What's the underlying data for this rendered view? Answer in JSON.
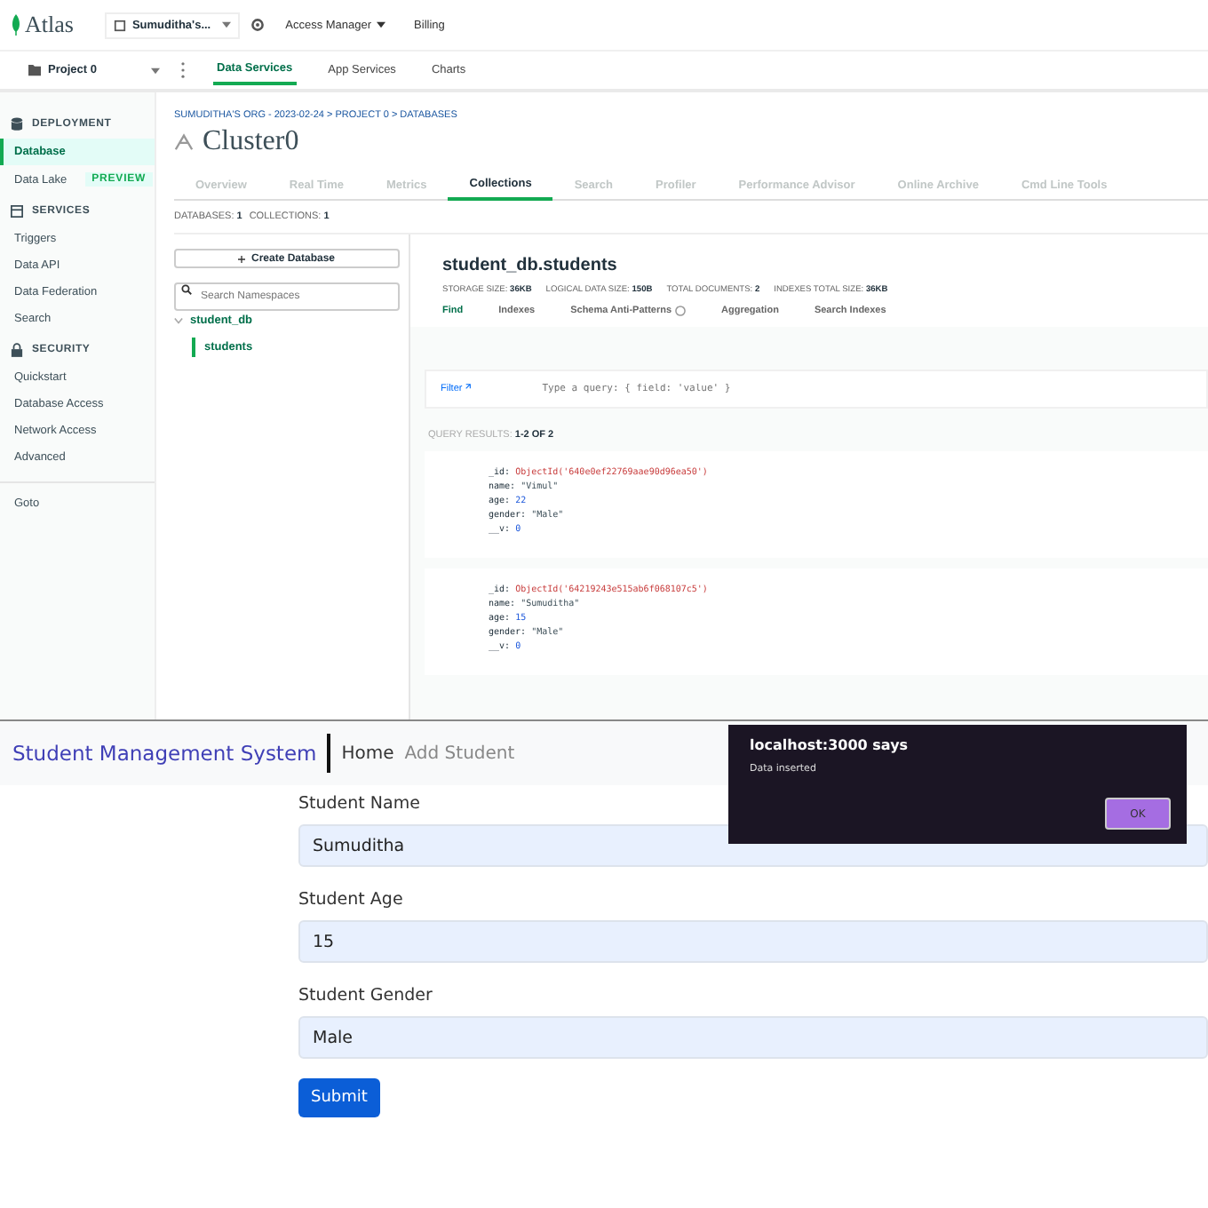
{
  "atlas": {
    "topbar": {
      "logo": "Atlas",
      "org": "Sumuditha's...",
      "nav": [
        {
          "label": "Access Manager",
          "kind": "dropdown"
        },
        {
          "label": "Billing",
          "kind": "link"
        }
      ]
    },
    "projectbar": {
      "project": "Project 0",
      "tabs": [
        {
          "label": "Data Services",
          "selected": true
        },
        {
          "label": "App Services",
          "selected": false
        },
        {
          "label": "Charts",
          "selected": false
        }
      ]
    },
    "sidebar": {
      "sections": [
        {
          "title": "DEPLOYMENT",
          "items": [
            {
              "label": "Database",
              "selected": true
            },
            {
              "label": "Data Lake",
              "selected": false,
              "badge": "PREVIEW"
            }
          ]
        },
        {
          "title": "SERVICES",
          "items": [
            {
              "label": "Triggers",
              "selected": false
            },
            {
              "label": "Data API",
              "selected": false
            },
            {
              "label": "Data Federation",
              "selected": false
            },
            {
              "label": "Search",
              "selected": false
            }
          ]
        },
        {
          "title": "SECURITY",
          "items": [
            {
              "label": "Quickstart",
              "selected": false
            },
            {
              "label": "Database Access",
              "selected": false
            },
            {
              "label": "Network Access",
              "selected": false
            },
            {
              "label": "Advanced",
              "selected": false
            }
          ]
        }
      ],
      "footer": "Goto"
    },
    "breadcrumb": "SUMUDITHA'S ORG - 2023-02-24 > PROJECT 0 > DATABASES",
    "cluster": "Cluster0",
    "tabs": [
      {
        "label": "Overview",
        "selected": false
      },
      {
        "label": "Real Time",
        "selected": false
      },
      {
        "label": "Metrics",
        "selected": false
      },
      {
        "label": "Collections",
        "selected": true
      },
      {
        "label": "Search",
        "selected": false
      },
      {
        "label": "Profiler",
        "selected": false
      },
      {
        "label": "Performance Advisor",
        "selected": false
      },
      {
        "label": "Online Archive",
        "selected": false
      },
      {
        "label": "Cmd Line Tools",
        "selected": false
      }
    ],
    "counts": [
      {
        "label": "DATABASES:",
        "value": "1"
      },
      {
        "label": "COLLECTIONS:",
        "value": "1"
      }
    ],
    "create_button": "Create Database",
    "search": {
      "placeholder": "Search Namespaces"
    },
    "tree": [
      {
        "label": "student_db",
        "expanded": true,
        "children": [
          {
            "label": "students",
            "selected": true
          }
        ]
      }
    ],
    "collection": {
      "title": "student_db.students",
      "stats": [
        {
          "label": "STORAGE SIZE:",
          "value": "36KB"
        },
        {
          "label": "LOGICAL DATA SIZE:",
          "value": "150B"
        },
        {
          "label": "TOTAL DOCUMENTS:",
          "value": "2"
        },
        {
          "label": "INDEXES TOTAL SIZE:",
          "value": "36KB"
        }
      ],
      "tabs": [
        {
          "label": "Find",
          "selected": true,
          "info": false
        },
        {
          "label": "Indexes",
          "selected": false,
          "info": false
        },
        {
          "label": "Schema Anti-Patterns",
          "selected": false,
          "info": true
        },
        {
          "label": "Aggregation",
          "selected": false,
          "info": false
        },
        {
          "label": "Search Indexes",
          "selected": false,
          "info": false
        }
      ],
      "filter": {
        "label": "Filter",
        "placeholder": "Type a query: { field: 'value' }"
      },
      "results": {
        "label": "QUERY RESULTS:",
        "value": "1-2 OF 2"
      },
      "documents": [
        {
          "fields": [
            {
              "key": "_id:",
              "value": "ObjectId('640e0ef22769aae90d96ea50')",
              "kind": "objectid"
            },
            {
              "key": "name:",
              "value": "\"Vimul\"",
              "kind": "string"
            },
            {
              "key": "age:",
              "value": "22",
              "kind": "number"
            },
            {
              "key": "gender:",
              "value": "\"Male\"",
              "kind": "string"
            },
            {
              "key": "__v:",
              "value": "0",
              "kind": "number"
            }
          ]
        },
        {
          "fields": [
            {
              "key": "_id:",
              "value": "ObjectId('64219243e515ab6f068107c5')",
              "kind": "objectid"
            },
            {
              "key": "name:",
              "value": "\"Sumuditha\"",
              "kind": "string"
            },
            {
              "key": "age:",
              "value": "15",
              "kind": "number"
            },
            {
              "key": "gender:",
              "value": "\"Male\"",
              "kind": "string"
            },
            {
              "key": "__v:",
              "value": "0",
              "kind": "number"
            }
          ]
        }
      ]
    }
  },
  "app": {
    "brand": "Student Management System",
    "nav": [
      {
        "label": "Home",
        "selected": true
      },
      {
        "label": "Add Student",
        "selected": false
      }
    ],
    "fields": [
      {
        "label": "Student Name",
        "value": "Sumuditha"
      },
      {
        "label": "Student Age",
        "value": "15"
      },
      {
        "label": "Student Gender",
        "value": "Male"
      }
    ],
    "submit": "Submit",
    "dialog": {
      "title": "localhost:3000 says",
      "message": "Data inserted",
      "button": "OK"
    }
  }
}
